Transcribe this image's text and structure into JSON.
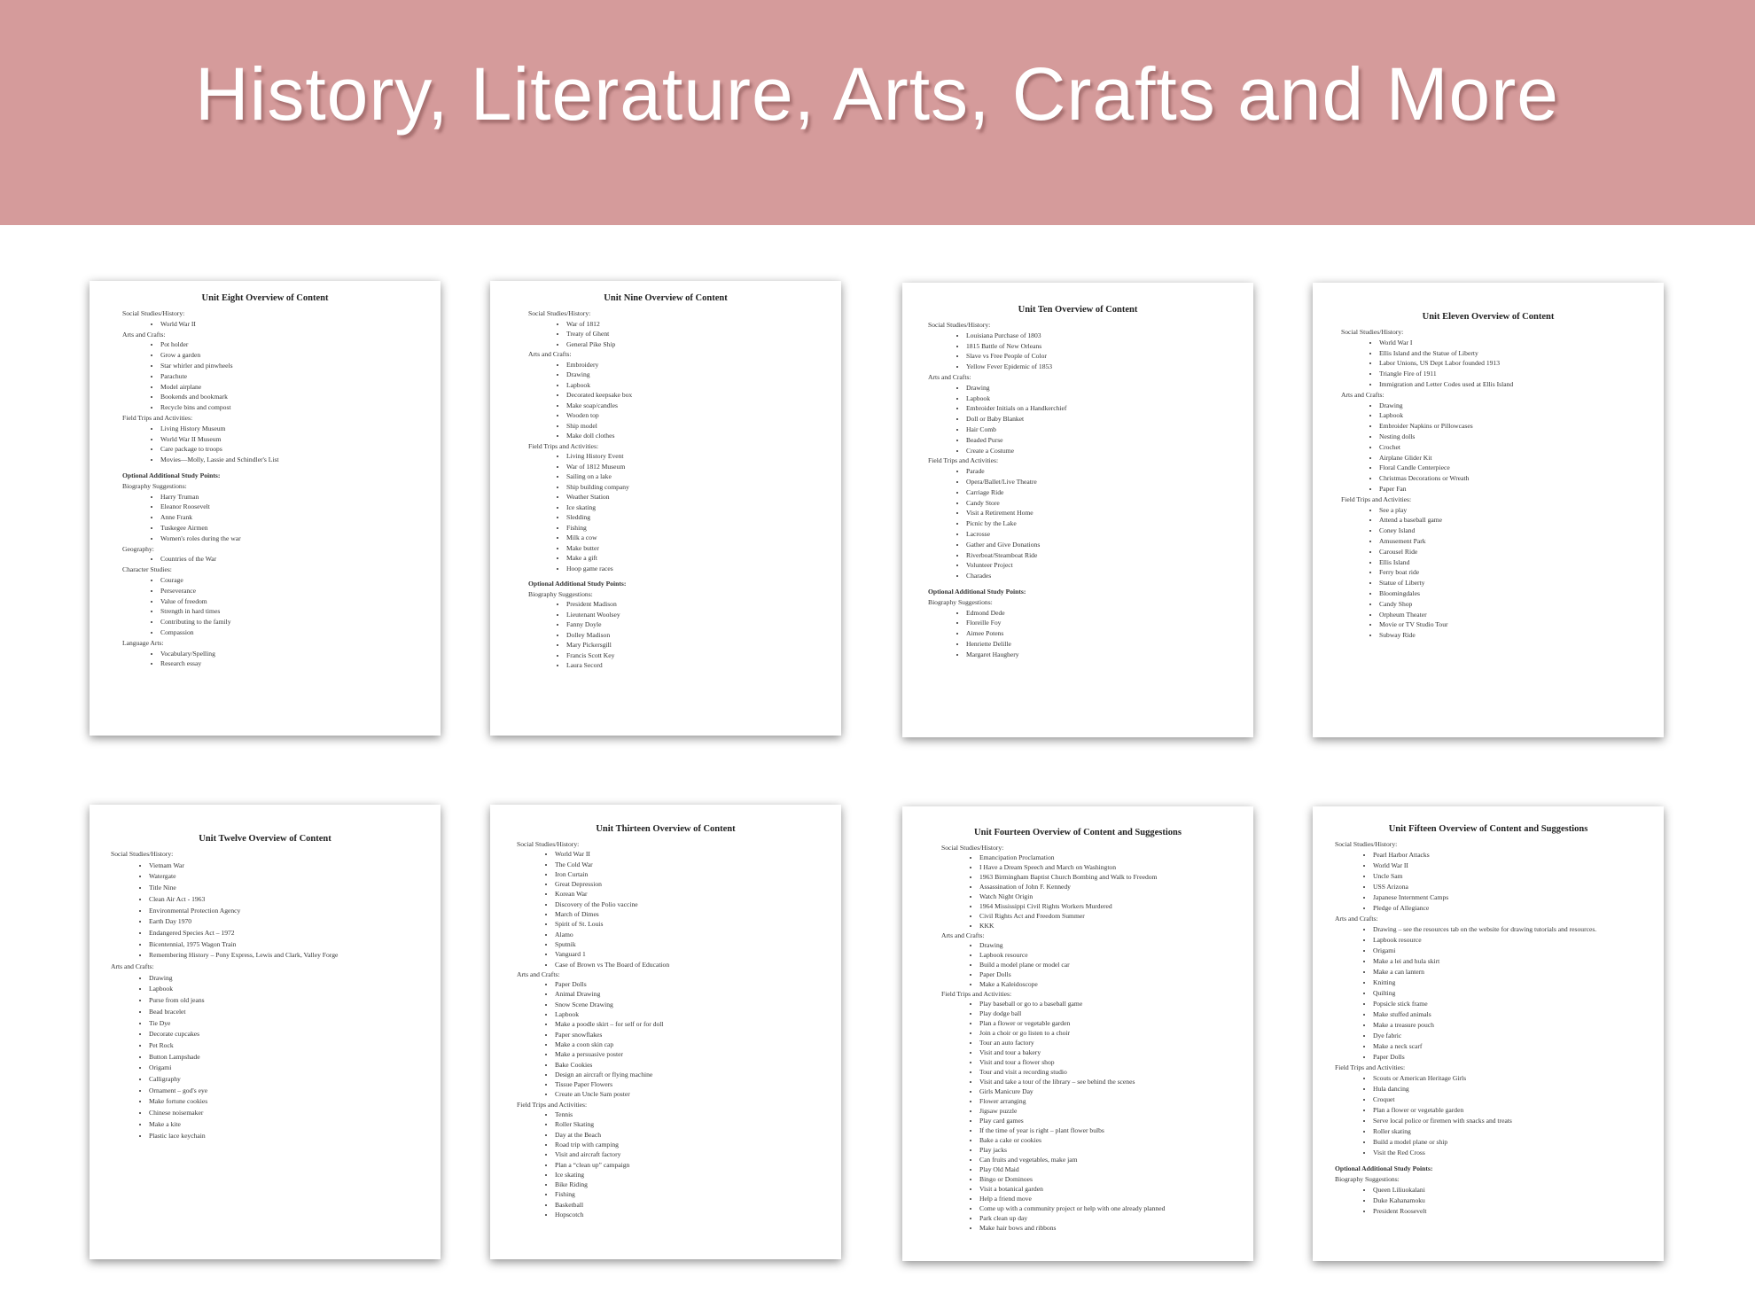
{
  "banner": {
    "title": "History, Literature, Arts, Crafts and More"
  },
  "pages": [
    {
      "title": "Unit Eight Overview of Content",
      "sections": [
        {
          "heading": "Social Studies/History:",
          "items": [
            "World War II"
          ]
        },
        {
          "heading": "Arts and Crafts:",
          "items": [
            "Pot holder",
            "Grow a garden",
            "Star whirler and pinwheels",
            "Parachute",
            "Model airplane",
            "Bookends and bookmark",
            "Recycle bins and compost"
          ]
        },
        {
          "heading": "Field Trips and Activities:",
          "items": [
            "Living History Museum",
            "World War II Museum",
            "Care package to troops",
            "Movies—Molly, Lassie and Schindler's List"
          ]
        },
        {
          "heading": "Optional Additional Study Points:",
          "bold": true,
          "items": []
        },
        {
          "heading": "Biography Suggestions:",
          "items": [
            "Harry Truman",
            "Eleanor Roosevelt",
            "Anne Frank",
            "Tuskegee Airmen",
            "Women's roles during the war"
          ]
        },
        {
          "heading": "Geography:",
          "items": [
            "Countries of the War"
          ]
        },
        {
          "heading": "Character Studies:",
          "items": [
            "Courage",
            "Perseverance",
            "Value of freedom",
            "Strength in hard times",
            "Contributing to the family",
            "Compassion"
          ]
        },
        {
          "heading": "Language Arts:",
          "items": [
            "Vocabulary/Spelling",
            "Research essay"
          ]
        }
      ]
    },
    {
      "title": "Unit Nine Overview of Content",
      "sections": [
        {
          "heading": "Social Studies/History:",
          "items": [
            "War of 1812",
            "Treaty of Ghent",
            "General Pike Ship"
          ]
        },
        {
          "heading": "Arts and Crafts:",
          "items": [
            "Embroidery",
            "Drawing",
            "Lapbook",
            "Decorated keepsake box",
            "Make soap/candles",
            "Wooden top",
            "Ship model",
            "Make doll clothes"
          ]
        },
        {
          "heading": "Field Trips and Activities:",
          "items": [
            "Living History Event",
            "War of 1812 Museum",
            "Sailing on a lake",
            "Ship building company",
            "Weather Station",
            "Ice skating",
            "Sledding",
            "Fishing",
            "Milk a cow",
            "Make butter",
            "Make a gift",
            "Hoop game races"
          ]
        },
        {
          "heading": "Optional Additional Study Points:",
          "bold": true,
          "items": []
        },
        {
          "heading": "Biography Suggestions:",
          "items": [
            "President Madison",
            "Lieutenant Woolsey",
            "Fanny Doyle",
            "Dolley Madison",
            "Mary Pickersgill",
            "Francis Scott Key",
            "Laura Secord"
          ]
        }
      ]
    },
    {
      "title": "Unit Ten Overview of Content",
      "sections": [
        {
          "heading": "Social Studies/History:",
          "items": [
            "Louisiana Purchase of 1803",
            "1815 Battle of New Orleans",
            "Slave vs Free People of Color",
            "Yellow Fever Epidemic of 1853"
          ]
        },
        {
          "heading": "Arts and Crafts:",
          "items": [
            "Drawing",
            "Lapbook",
            "Embroider Initials on a Handkerchief",
            "Doll or Baby Blanket",
            "Hair Comb",
            "Beaded Purse",
            "Create a Costume"
          ]
        },
        {
          "heading": "Field Trips and Activities:",
          "items": [
            "Parade",
            "Opera/Ballet/Live Theatre",
            "Carriage Ride",
            "Candy Store",
            "Visit a Retirement Home",
            "Picnic by the Lake",
            "Lacrosse",
            "Gather and Give Donations",
            "Riverboat/Steamboat Ride",
            "Volunteer Project",
            "Charades"
          ]
        },
        {
          "heading": "Optional Additional Study Points:",
          "bold": true,
          "items": []
        },
        {
          "heading": "Biography Suggestions:",
          "items": [
            "Edmond Dede",
            "Floreille Foy",
            "Aimee Potens",
            "Henriette Delille",
            "Margaret Haughery"
          ]
        }
      ]
    },
    {
      "title": "Unit Eleven Overview of Content",
      "sections": [
        {
          "heading": "Social Studies/History:",
          "items": [
            "World War I",
            "Ellis Island and the Statue of Liberty",
            "Labor Unions, US Dept Labor founded 1913",
            "Triangle Fire of 1911",
            "Immigration and Letter Codes used at Ellis Island"
          ]
        },
        {
          "heading": "Arts and Crafts:",
          "items": [
            "Drawing",
            "Lapbook",
            "Embroider Napkins or Pillowcases",
            "Nesting dolls",
            "Crochet",
            "Airplane Glider Kit",
            "Floral Candle Centerpiece",
            "Christmas Decorations or Wreath",
            "Paper Fan"
          ]
        },
        {
          "heading": "Field Trips and Activities:",
          "items": [
            "See a play",
            "Attend a baseball game",
            "Coney Island",
            "Amusement Park",
            "Carousel Ride",
            "Ellis Island",
            "Ferry boat ride",
            "Statue of Liberty",
            "Bloomingdales",
            "Candy Shop",
            "Orpheum Theater",
            "Movie or TV Studio Tour",
            "Subway Ride"
          ]
        }
      ]
    },
    {
      "title": "Unit Twelve Overview of Content",
      "sections": [
        {
          "heading": "Social Studies/History:",
          "items": [
            "Vietnam War",
            "Watergate",
            "Title Nine",
            "Clean Air Act - 1963",
            "Environmental Protection Agency",
            "Earth Day 1970",
            "Endangered Species Act – 1972",
            "Bicentennial, 1975 Wagon Train",
            "Remembering History – Pony Express, Lewis and Clark, Valley Forge"
          ]
        },
        {
          "heading": "Arts and Crafts:",
          "items": [
            "Drawing",
            "Lapbook",
            "Purse from old jeans",
            "Bead bracelet",
            "Tie Dye",
            "Decorate cupcakes",
            "Pet Rock",
            "Button Lampshade",
            "Origami",
            "Calligraphy",
            "Ornament – god's eye",
            "Make fortune cookies",
            "Chinese noisemaker",
            "Make a kite",
            "Plastic lace keychain"
          ]
        }
      ]
    },
    {
      "title": "Unit Thirteen Overview of Content",
      "sections": [
        {
          "heading": "Social Studies/History:",
          "items": [
            "World War II",
            "The Cold War",
            "Iron Curtain",
            "Great Depression",
            "Korean War",
            "Discovery of the Polio vaccine",
            "March of Dimes",
            "Spirit of St. Louis",
            "Alamo",
            "Sputnik",
            "Vanguard 1",
            "Case of Brown vs The Board of Education"
          ]
        },
        {
          "heading": "Arts and Crafts:",
          "items": [
            "Paper Dolls",
            "Animal Drawing",
            "Snow Scene Drawing",
            "Lapbook",
            "Make a poodle skirt – for self or for doll",
            "Paper snowflakes",
            "Make a coon skin cap",
            "Make a persuasive poster",
            "Bake Cookies",
            "Design an aircraft or flying machine",
            "Tissue Paper Flowers",
            "Create an Uncle Sam poster"
          ]
        },
        {
          "heading": "Field Trips and Activities:",
          "items": [
            "Tennis",
            "Roller Skating",
            "Day at the Beach",
            "Road trip with camping",
            "Visit and aircraft factory",
            "Plan a “clean up” campaign",
            "Ice skating",
            "Bike Riding",
            "Fishing",
            "Basketball",
            "Hopscotch"
          ]
        }
      ]
    },
    {
      "title": "Unit Fourteen Overview of Content and Suggestions",
      "sections": [
        {
          "heading": "Social Studies/History:",
          "items": [
            "Emancipation Proclamation",
            "I Have a Dream Speech and March on Washington",
            "1963 Birmingham Baptist Church Bombing and Walk to Freedom",
            "Assassination of John F. Kennedy",
            "Watch Night Origin",
            "1964 Mississippi Civil Rights Workers Murdered",
            "Civil Rights Act and Freedom Summer",
            "KKK"
          ]
        },
        {
          "heading": "Arts and Crafts:",
          "items": [
            "Drawing",
            "Lapbook resource",
            "Build a model plane or model car",
            "Paper Dolls",
            "Make a Kaleidoscope"
          ]
        },
        {
          "heading": "Field Trips and Activities:",
          "items": [
            "Play baseball or go to a baseball game",
            "Play dodge ball",
            "Plan a flower or vegetable garden",
            "Join a choir or go listen to a choir",
            "Tour an auto factory",
            "Visit and tour a bakery",
            "Visit and tour a flower shop",
            "Tour and visit a recording studio",
            "Visit and take a tour of the library – see behind the scenes",
            "Girls Manicure Day",
            "Flower arranging",
            "Jigsaw puzzle",
            "Play card games",
            "If the time of year is right – plant flower bulbs",
            "Bake a cake or cookies",
            "Play jacks",
            "Can fruits and vegetables, make jam",
            "Play Old Maid",
            "Bingo or Dominoes",
            "Visit a botanical garden",
            "Help a friend move",
            "Come up with a community project or help with one already planned",
            "Park clean up day",
            "Make hair bows and ribbons"
          ]
        }
      ]
    },
    {
      "title": "Unit Fifteen Overview of Content and Suggestions",
      "sections": [
        {
          "heading": "Social Studies/History:",
          "items": [
            "Pearl Harbor Attacks",
            "World War II",
            "Uncle Sam",
            "USS Arizona",
            "Japanese Internment Camps",
            "Pledge of Allegiance"
          ]
        },
        {
          "heading": "Arts and Crafts:",
          "items": [
            "Drawing – see the resources tab on the website for drawing tutorials and resources.",
            "Lapbook resource",
            "Origami",
            "Make a lei and hula skirt",
            "Make a can lantern",
            "Knitting",
            "Quilting",
            "Popsicle stick frame",
            "Make stuffed animals",
            "Make a treasure pouch",
            "Dye fabric",
            "Make a neck scarf",
            "Paper Dolls"
          ]
        },
        {
          "heading": "Field Trips and Activities:",
          "items": [
            "Scouts or American Heritage Girls",
            "Hula dancing",
            "Croquet",
            "Plan a flower or vegetable garden",
            "Serve local police or firemen with snacks and treats",
            "Roller skating",
            "Build a model plane or ship",
            "Visit the Red Cross"
          ]
        },
        {
          "heading": "Optional Additional Study Points:",
          "bold": true,
          "items": []
        },
        {
          "heading": "Biography Suggestions:",
          "items": [
            "Queen Liliuokalani",
            "Duke Kahanamoku",
            "President Roosevelt"
          ]
        }
      ]
    }
  ]
}
